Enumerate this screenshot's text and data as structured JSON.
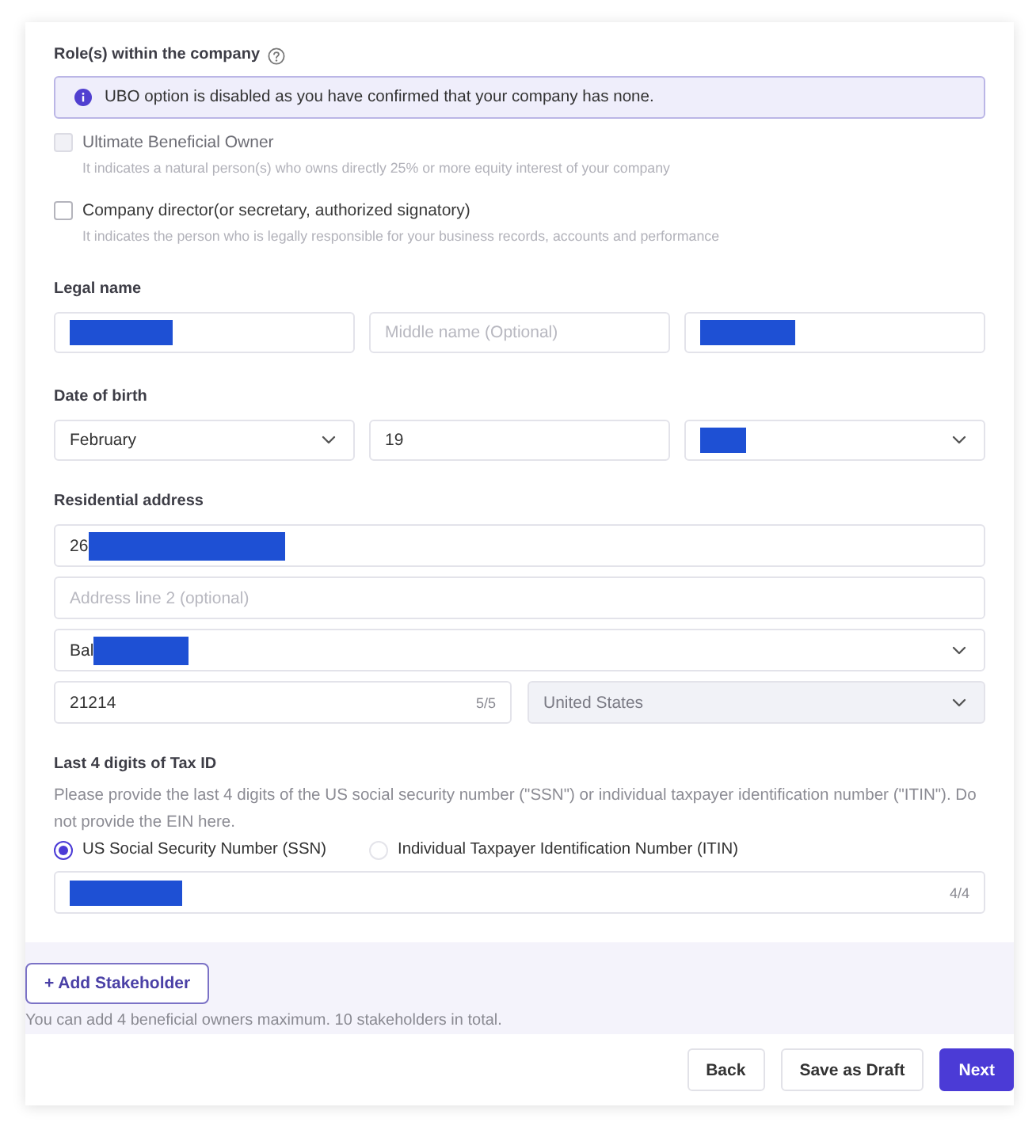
{
  "roles": {
    "label": "Role(s) within the company",
    "notice": "UBO option is disabled as you have confirmed that your company has none.",
    "options": [
      {
        "label": "Ultimate Beneficial Owner",
        "description": "It indicates a natural person(s) who owns directly 25% or more equity interest of your company",
        "checked": false,
        "disabled": true
      },
      {
        "label": "Company director(or secretary, authorized signatory)",
        "description": "It indicates the person who is legally responsible for your business records, accounts and performance",
        "checked": false,
        "disabled": false
      }
    ]
  },
  "legal_name": {
    "label": "Legal name",
    "fields": [
      {
        "kind": "text",
        "redacted": true
      },
      {
        "kind": "text",
        "placeholder": "Middle name (Optional)",
        "redacted": false
      },
      {
        "kind": "text",
        "redacted": true
      }
    ]
  },
  "date_of_birth": {
    "label": "Date of birth",
    "fields": [
      {
        "kind": "select",
        "value": "February",
        "redacted": false
      },
      {
        "kind": "text",
        "value": "19",
        "redacted": false
      },
      {
        "kind": "select",
        "redacted": true
      }
    ]
  },
  "residential_address": {
    "label": "Residential address",
    "rows": [
      {
        "fields": [
          {
            "kind": "text",
            "value": "26",
            "redacted": true
          }
        ]
      },
      {
        "fields": [
          {
            "kind": "text",
            "placeholder": "Address line 2 (optional)",
            "redacted": false
          }
        ]
      },
      {
        "fields": [
          {
            "kind": "select",
            "value": "Bal",
            "redacted": true
          }
        ]
      },
      {
        "fields": [
          {
            "kind": "text",
            "value": "21214",
            "counter": "5/5",
            "redacted": false,
            "disabled": false
          },
          {
            "kind": "select",
            "value": "United States",
            "redacted": false,
            "disabled": true
          }
        ]
      }
    ]
  },
  "tax_id": {
    "label": "Last 4 digits of Tax ID",
    "hint": "Please provide the last 4 digits of the US social security number (\"SSN\") or individual taxpayer identification number (\"ITIN\"). Do not provide the EIN here.",
    "options": [
      {
        "label": "US Social Security Number (SSN)",
        "selected": true
      },
      {
        "label": "Individual Taxpayer Identification Number (ITIN)",
        "selected": false
      }
    ],
    "field": {
      "kind": "text",
      "counter": "4/4",
      "redacted": true
    }
  },
  "stakeholders": {
    "add_button": "+ Add Stakeholder",
    "note": "You can add 4 beneficial owners maximum. 10 stakeholders in total."
  },
  "footer": {
    "buttons": [
      {
        "label": "Back",
        "kind": "secondary"
      },
      {
        "label": "Save as Draft",
        "kind": "secondary"
      },
      {
        "label": "Next",
        "kind": "primary"
      }
    ]
  }
}
